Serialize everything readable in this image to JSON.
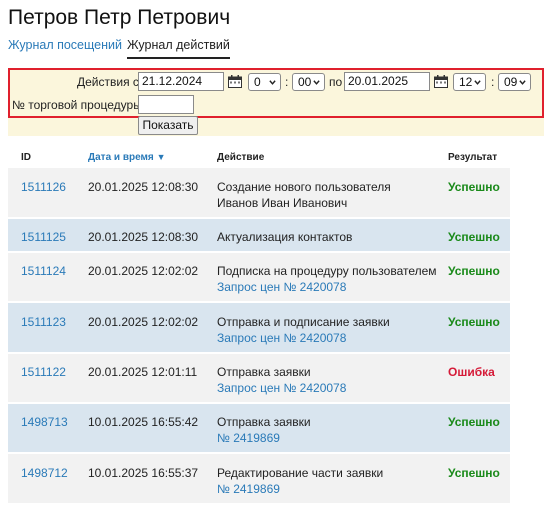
{
  "page": {
    "title": "Петров Петр Петрович"
  },
  "tabs": [
    {
      "label": "Журнал посещений",
      "active": false
    },
    {
      "label": "Журнал действий",
      "active": true
    }
  ],
  "filter": {
    "from_label": "Действия с",
    "from_date": "21.12.2024",
    "from_hour": "0",
    "from_min": "00",
    "to_label": "по",
    "to_date": "20.01.2025",
    "to_hour": "12",
    "to_min": "09",
    "procedure_label": "№ торговой процедуры",
    "procedure_value": "",
    "submit_label": "Показать",
    "highlight_color": "#e0202d"
  },
  "table": {
    "headers": {
      "id": "ID",
      "datetime": "Дата и время",
      "sort_arrow": "▼",
      "action": "Действие",
      "result": "Результат"
    },
    "rows": [
      {
        "id": "1511126",
        "datetime": "20.01.2025 12:08:30",
        "action": "Создание нового пользователя",
        "action_sub": "Иванов Иван Иванович",
        "sub_link": false,
        "result": "Успешно",
        "status": "ok"
      },
      {
        "id": "1511125",
        "datetime": "20.01.2025 12:08:30",
        "action": "Актуализация контактов",
        "action_sub": "",
        "sub_link": false,
        "result": "Успешно",
        "status": "ok"
      },
      {
        "id": "1511124",
        "datetime": "20.01.2025 12:02:02",
        "action": "Подписка на процедуру пользователем",
        "action_sub": "Запрос цен № 2420078",
        "sub_link": true,
        "result": "Успешно",
        "status": "ok"
      },
      {
        "id": "1511123",
        "datetime": "20.01.2025 12:02:02",
        "action": "Отправка и подписание заявки",
        "action_sub": "Запрос цен № 2420078",
        "sub_link": true,
        "result": "Успешно",
        "status": "ok"
      },
      {
        "id": "1511122",
        "datetime": "20.01.2025 12:01:11",
        "action": "Отправка заявки",
        "action_sub": "Запрос цен № 2420078",
        "sub_link": true,
        "result": "Ошибка",
        "status": "err"
      },
      {
        "id": "1498713",
        "datetime": "10.01.2025 16:55:42",
        "action": "Отправка заявки",
        "action_sub": "№ 2419869",
        "sub_link": true,
        "result": "Успешно",
        "status": "ok"
      },
      {
        "id": "1498712",
        "datetime": "10.01.2025 16:55:37",
        "action": "Редактирование части заявки",
        "action_sub": "№ 2419869",
        "sub_link": true,
        "result": "Успешно",
        "status": "ok"
      }
    ]
  },
  "colors": {
    "link": "#2a7ab8",
    "success": "#1a8a1a",
    "error": "#d51a38",
    "row_alt": "#d9e5ef",
    "row": "#f2f2f2"
  }
}
